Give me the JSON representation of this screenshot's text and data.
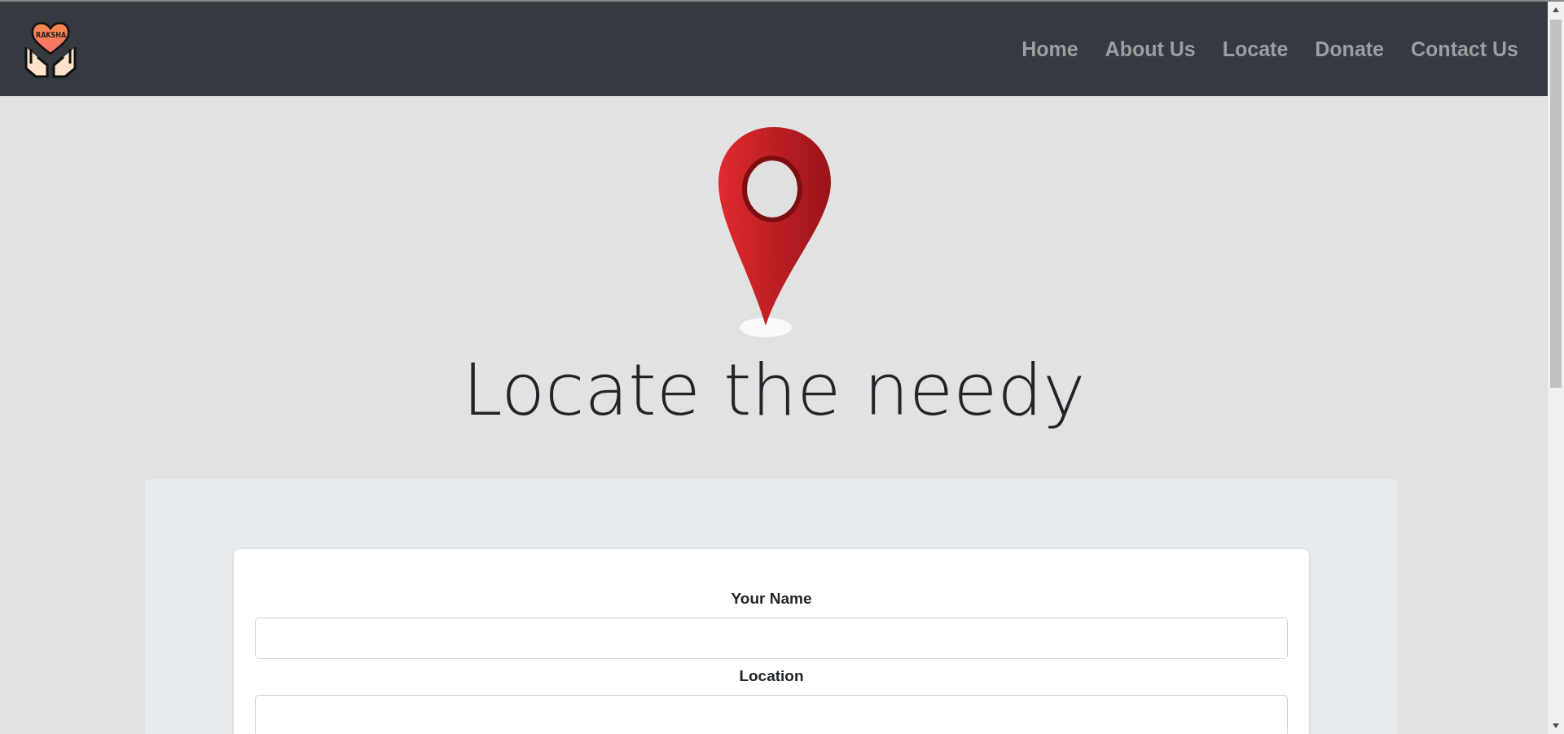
{
  "navbar": {
    "logo_text": "RAKSHA",
    "links": [
      {
        "label": "Home"
      },
      {
        "label": "About Us"
      },
      {
        "label": "Locate"
      },
      {
        "label": "Donate"
      },
      {
        "label": "Contact Us"
      }
    ]
  },
  "hero": {
    "title": "Locate the needy"
  },
  "form": {
    "fields": [
      {
        "label": "Your Name"
      },
      {
        "label": "Location"
      }
    ]
  }
}
